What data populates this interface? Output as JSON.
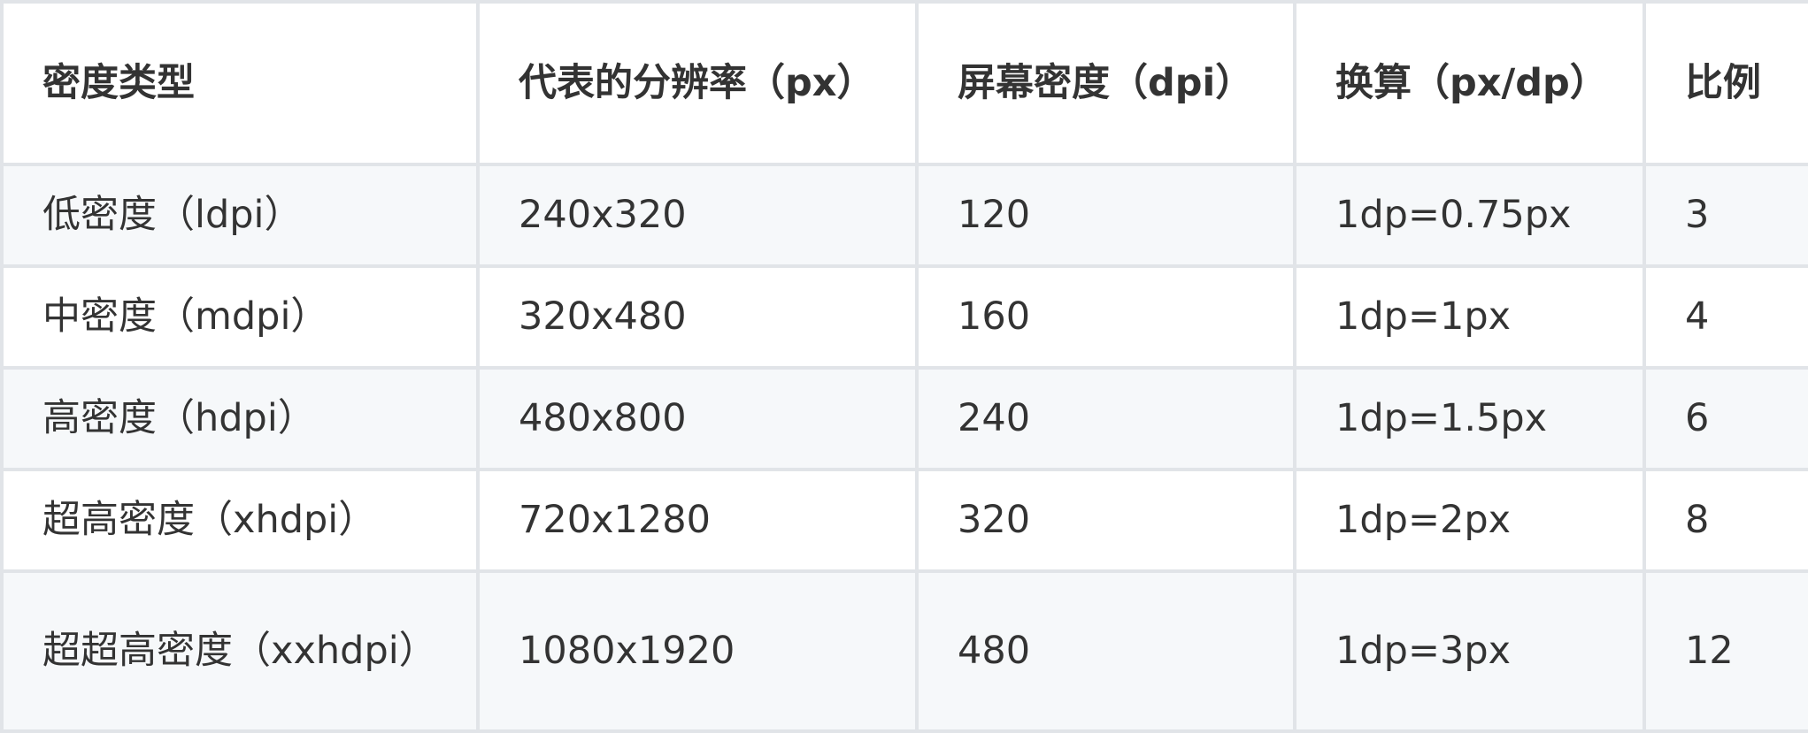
{
  "table": {
    "headers": [
      "密度类型",
      "代表的分辨率（px）",
      "屏幕密度（dpi）",
      "换算（px/dp）",
      "比例"
    ],
    "rows": [
      [
        "低密度（ldpi）",
        "240x320",
        "120",
        "1dp=0.75px",
        "3"
      ],
      [
        "中密度（mdpi）",
        "320x480",
        "160",
        "1dp=1px",
        "4"
      ],
      [
        "高密度（hdpi）",
        "480x800",
        "240",
        "1dp=1.5px",
        "6"
      ],
      [
        "超高密度（xhdpi）",
        "720x1280",
        "320",
        "1dp=2px",
        "8"
      ],
      [
        "超超高密度（xxhdpi）",
        "1080x1920",
        "480",
        "1dp=3px",
        "12"
      ]
    ]
  }
}
